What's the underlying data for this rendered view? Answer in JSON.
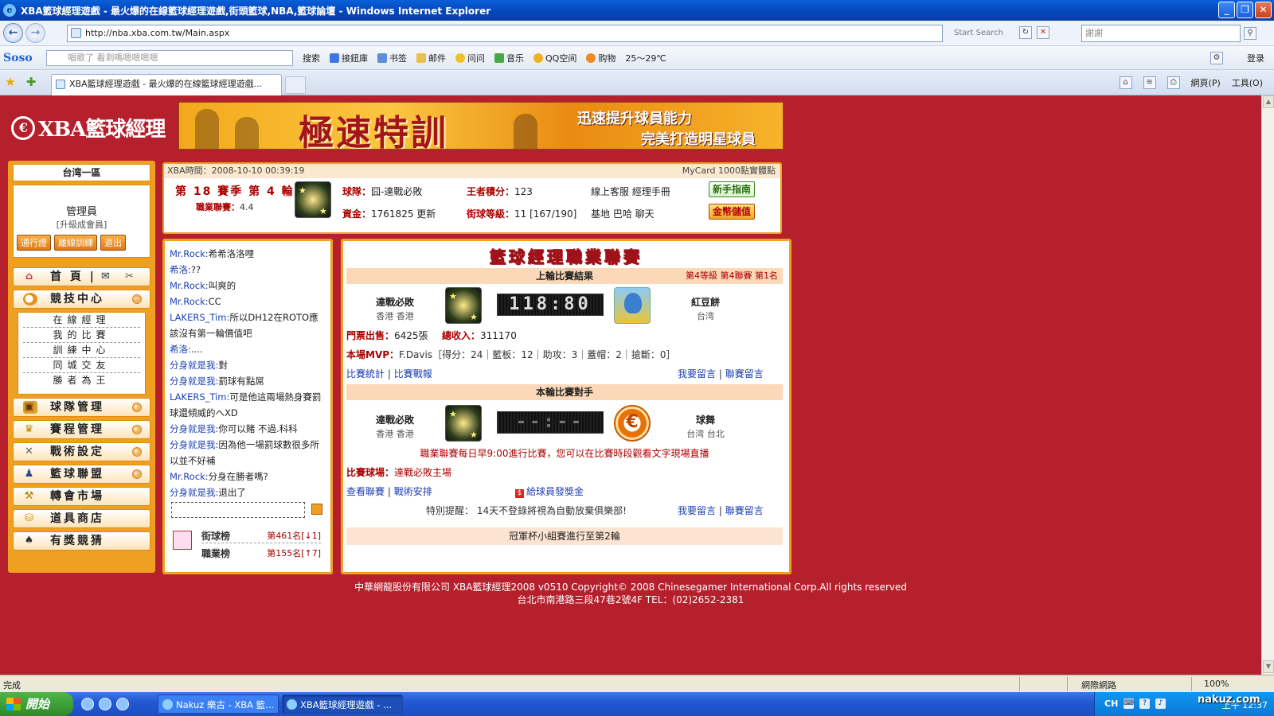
{
  "window": {
    "title": "XBA籃球經理遊戲 - 最火爆的在線籃球經理遊戲,街頭籃球,NBA,籃球論壇 - Windows Internet Explorer"
  },
  "address": {
    "url": "http://nba.xba.com.tw/Main.aspx",
    "search_label": "Start Search",
    "search_value": "謝謝"
  },
  "soso_toolbar": {
    "logo": "Soso",
    "input_placeholder": "唱歌了 看到嗎嗯嗯嗯嗯",
    "search_btn": "搜索",
    "items": [
      "接鈕庫",
      "书签",
      "邮件",
      "问问",
      "音乐",
      "QQ空间",
      "购物",
      "25～29℃"
    ],
    "login": "登录"
  },
  "tabs": {
    "active_tab": "XBA籃球經理遊戲 - 最火爆的在線籃球經理遊戲...",
    "right_items": [
      "網頁(P)",
      "工具(O)"
    ]
  },
  "site": {
    "logo_text": "XBA籃球經理",
    "banner_main": "極速特訓",
    "banner_line1": "迅速提升球員能力",
    "banner_line2": "完美打造明星球員"
  },
  "left": {
    "server": "台湾一區",
    "username": "管理員",
    "upgrade_link": "[升級成會員]",
    "buttons": [
      "通行證",
      "離線訓練",
      "退出"
    ],
    "home_label": "首 頁 |",
    "menu": [
      "競技中心",
      "球隊管理",
      "賽程管理",
      "戰術設定",
      "籃球聯盟",
      "轉會市場",
      "道具商店",
      "有獎競猜"
    ],
    "sub_menu": [
      "在線經理",
      "我的比賽",
      "訓練中心",
      "同城交友",
      "勝者為王"
    ]
  },
  "info": {
    "time": "XBA時間：2008-10-10 00:39:19",
    "mycard": "MyCard 1000點實體點",
    "season": "第 18 賽季 第 4 輪",
    "pro_rating_label": "職業聯賽：",
    "pro_rating_value": "4.4",
    "team_label": "球隊：",
    "team_value": "囧-達戰必敗",
    "king_label": "王者積分：",
    "king_value": "123",
    "funds_label": "資金：",
    "funds_value": "1761825 更新",
    "street_label": "街球等級：",
    "street_value": "11 [167/190]",
    "service_links": "線上客服 經理手冊",
    "base_links": "基地 巴哈 聊天",
    "newbie_btn": "新手指南",
    "deposit_btn": "金幣儲值"
  },
  "chat": {
    "messages": [
      {
        "who": "Mr.Rock:",
        "text": "希希洛洛哩"
      },
      {
        "who": "希洛:",
        "text": "??"
      },
      {
        "who": "Mr.Rock:",
        "text": "叫爽的"
      },
      {
        "who": "Mr.Rock:",
        "text": "CC"
      },
      {
        "who": "LAKERS_Tim:",
        "text": "所以DH12在ROTO應該沒有第一輪價值吧"
      },
      {
        "who": "希洛:",
        "text": "...."
      },
      {
        "who": "分身就是我:",
        "text": "對"
      },
      {
        "who": "分身就是我:",
        "text": "罰球有點屌"
      },
      {
        "who": "LAKERS_Tim:",
        "text": "可是他這兩場熱身賽罰球還傾威的ヘXD"
      },
      {
        "who": "分身就是我:",
        "text": "你可以賭 不過.科科"
      },
      {
        "who": "分身就是我:",
        "text": "因為他一場罰球數很多所以並不好補"
      },
      {
        "who": "Mr.Rock:",
        "text": "分身在勝者嗎?"
      },
      {
        "who": "分身就是我:",
        "text": "退出了"
      }
    ],
    "rank1_label": "街球榜",
    "rank1_value": "第461名[↓1]",
    "rank2_label": "職業榜",
    "rank2_value": "第155名[↑7]"
  },
  "league": {
    "title": "籃球經理職業聯賽",
    "last_result_head": "上輪比賽結果",
    "last_result_rank": "第4等級 第4聯賽 第1名",
    "home_team": "達戰必敗",
    "home_loc": "香港 香港",
    "score": "118:80",
    "away_team": "紅豆餅",
    "away_loc": "台湾",
    "ticket_label": "門票出售：",
    "ticket_value": "6425張",
    "income_label": "總收入：",
    "income_value": "311170",
    "mvp_label": "本場MVP：",
    "mvp_value": "F.Davis［得分：24｜籃板：12｜助攻：3｜蓋帽：2｜搶斷：0］",
    "stats_link": "比賽統計",
    "report_link": "比賽戰報",
    "comment_link": "我要留言",
    "league_comment_link": "聯賽留言",
    "next_head": "本輪比賽對手",
    "next_home_team": "達戰必敗",
    "next_home_loc": "香港 香港",
    "next_score": "--:--",
    "next_away_team": "球舞",
    "next_away_loc": "台湾 台北",
    "schedule_note": "職業聯賽每日早9:00進行比賽，您可以在比賽時段觀看文字現場直播",
    "venue_label": "比賽球場：",
    "venue_value": "達戰必敗主場",
    "view_league_link": "查看聯賽",
    "tactics_link": "戰術安排",
    "bonus_link": "給球員發獎金",
    "reminder": "特別提醒： 14天不登錄將視為自動放棄俱樂部!",
    "cup_note": "冠軍杯小組賽進行至第2輪"
  },
  "footer": {
    "line1": "中華網龍股份有限公司 XBA籃球經理2008 v0510    Copyright© 2008 Chinesegamer International Corp.All rights reserved",
    "line2": "台北市南港路三段47巷2號4F TEL：(02)2652-2381"
  },
  "status": {
    "text": "完成",
    "zone": "網際網路",
    "zoom": "100%"
  },
  "taskbar": {
    "start": "開始",
    "tasks": [
      "Nakuz 樂古 - XBA 籃...",
      "XBA籃球經理遊戲 - ..."
    ],
    "lang": "CH",
    "clock": "上午 12:37"
  },
  "watermark": "nakuz.com"
}
